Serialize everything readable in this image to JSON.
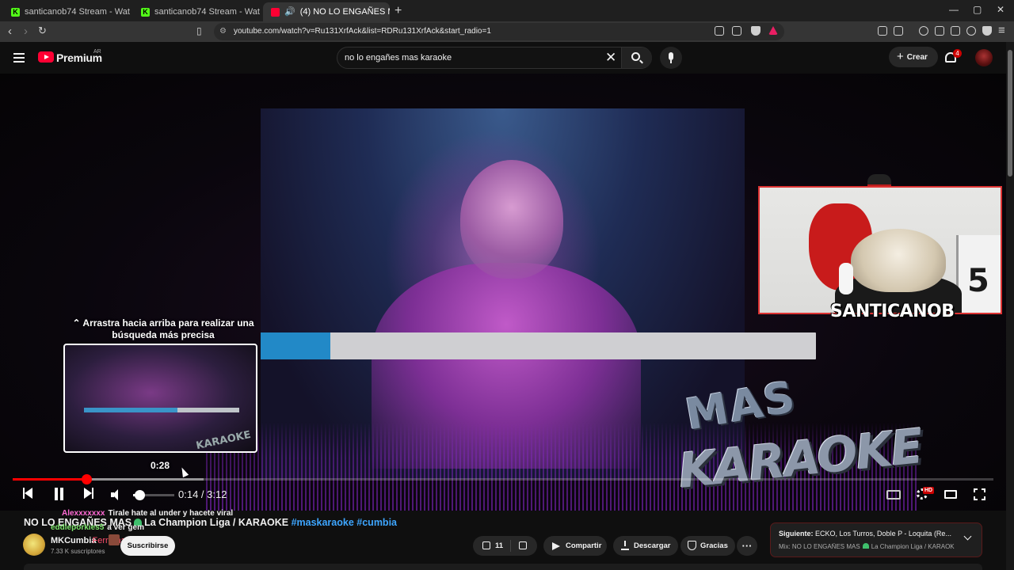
{
  "browser": {
    "tabs": [
      {
        "title": "santicanob74 Stream - Watch Live o",
        "favicon": "kick-icon",
        "active": false
      },
      {
        "title": "santicanob74 Stream - Watch Live o",
        "favicon": "kick-icon",
        "active": false
      },
      {
        "title": "(4) NO LO ENGAÑES MAS 💚",
        "favicon": "youtube-icon",
        "active": true
      }
    ],
    "new_tab": "+",
    "url": "youtube.com/watch?v=Ru131XrfAck&list=RDRu131XrfAck&start_radio=1",
    "window_controls": {
      "minimize": "—",
      "restore": "▢",
      "close": "✕"
    }
  },
  "masthead": {
    "logo_text": "Premium",
    "country_code": "AR",
    "search_query": "no lo engañes mas karaoke",
    "create_label": "Crear",
    "notifications_count": "4"
  },
  "player": {
    "swipe_hint": "⌃ Arrastra hacia arriba para realizar una búsqueda más precisa",
    "preview_time": "0:28",
    "time_current": "0:14",
    "time_total": "3:12",
    "time_display": "0:14 / 3:12",
    "progress_played": 0.075,
    "progress_loaded": 0.195,
    "volume_level": 0.15,
    "overlay_bar_fill": 0.125,
    "quality_badge": "HD",
    "webcam_name": "SANTICANOB",
    "webcam_shirt_number": "5",
    "watermark_line1": "MAS",
    "watermark_line2": "KARAOKE"
  },
  "chat_overlay": [
    {
      "user": "Alexxxxxxx",
      "message": "Tirale hate al under y hacete viral"
    },
    {
      "user": "eddieporkies5",
      "message": "a ver gem"
    }
  ],
  "video": {
    "title_text": "NO LO ENGAÑES MAS",
    "title_rest": "La Champion Liga / KARAOKE",
    "hashtags": [
      "#maskaraoke",
      "#cumbia"
    ],
    "channel_name": "MKCumbia",
    "channel_hint": "Ferrarhat",
    "subscribers": "7.33 K suscriptores",
    "subscribe_label": "Suscribirse",
    "like_count": "11",
    "share_label": "Compartir",
    "download_label": "Descargar",
    "thanks_label": "Gracias",
    "more_label": "···"
  },
  "up_next": {
    "label": "Siguiente:",
    "title": "ECKO, Los Turros, Doble P - Loquita (Re...",
    "mix_prefix": "Mix: NO LO ENGAÑES MAS",
    "mix_rest": "La Champion Liga / KARAOK..."
  },
  "colors": {
    "accent": "#ff0000",
    "hashtag": "#3ea6ff",
    "brand": "#ff0033"
  }
}
